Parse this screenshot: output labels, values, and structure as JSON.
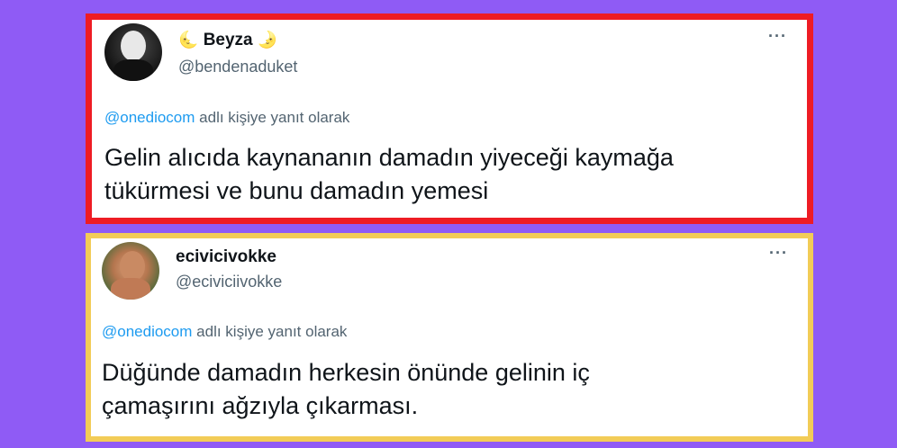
{
  "tweets": [
    {
      "name_prefix": "🌜",
      "name": "Beyza",
      "name_suffix": "🌛",
      "handle": "@bendenaduket",
      "reply_mention": "@onediocom",
      "reply_suffix": "adlı kişiye yanıt olarak",
      "text_line1": "Gelin alıcıda kaynananın damadın yiyeceği kaymağa",
      "text_line2": "tükürmesi ve bunu damadın yemesi",
      "more": "···",
      "border_color": "#ee1c24"
    },
    {
      "name": "ecivicivokke",
      "handle": "@eciviciivokke",
      "reply_mention": "@onediocom",
      "reply_suffix": "adlı kişiye yanıt olarak",
      "text_line1": "Düğünde damadın herkesin önünde gelinin iç",
      "text_line2": "çamaşırını ağzıyla çıkarması.",
      "more": "···",
      "border_color": "#f2cc57"
    }
  ],
  "background_color": "#8f5bf5"
}
